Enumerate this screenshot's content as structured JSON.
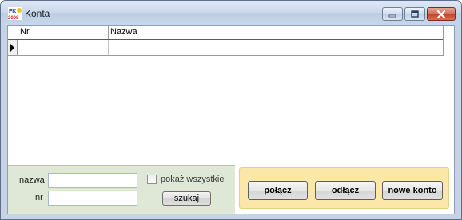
{
  "window": {
    "title": "Konta",
    "app_icon": "fk-2008-icon",
    "controls": {
      "minimize": "minimize-icon",
      "maximize": "maximize-icon",
      "close": "close-icon"
    }
  },
  "grid": {
    "columns": [
      "Nr",
      "Nazwa"
    ],
    "rows": [
      {
        "nr": "",
        "nazwa": ""
      }
    ]
  },
  "search": {
    "name_label": "nazwa",
    "name_value": "",
    "nr_label": "nr",
    "nr_value": "",
    "show_all_label": "pokaż wszystkie",
    "show_all_checked": false,
    "search_button": "szukaj"
  },
  "actions": {
    "connect": "połącz",
    "disconnect": "odłącz",
    "new_account": "nowe konto"
  },
  "colors": {
    "search_panel_bg": "#dfe8d6",
    "action_panel_bg": "#fbe7a8",
    "close_button": "#c2432a"
  }
}
